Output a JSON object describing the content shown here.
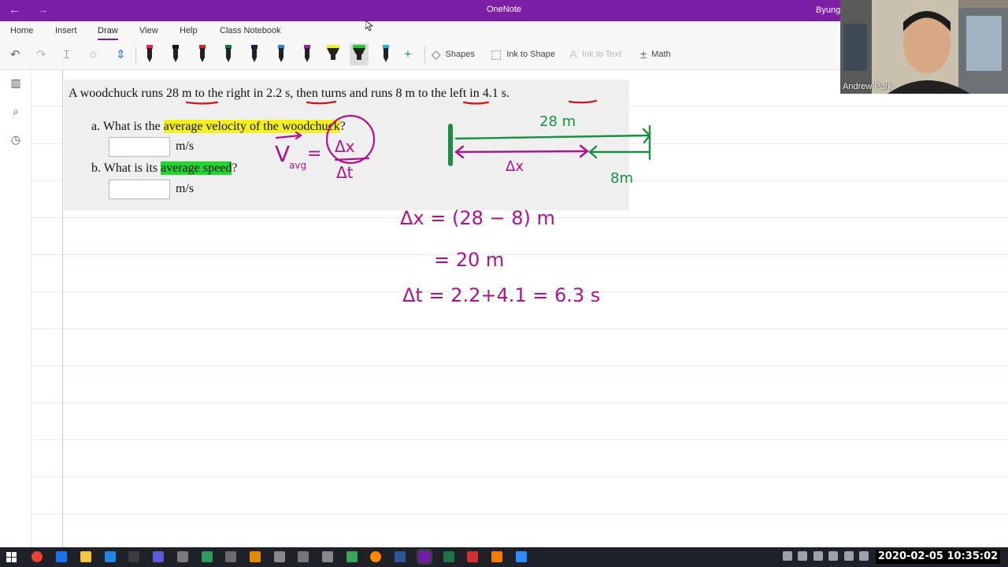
{
  "window": {
    "title": "OneNote",
    "user": "Byung"
  },
  "ribbon": {
    "tabs": [
      {
        "label": "Home"
      },
      {
        "label": "Insert"
      },
      {
        "label": "Draw"
      },
      {
        "label": "View"
      },
      {
        "label": "Help"
      },
      {
        "label": "Class Notebook"
      }
    ],
    "active_tab": "Draw",
    "tools": {
      "shapes": "Shapes",
      "ink_to_shape": "Ink to Shape",
      "ink_to_text": "Ink to Text",
      "math": "Math"
    },
    "pen_colors": [
      "#e91e63",
      "#111111",
      "#e11d1d",
      "#0b7d2f",
      "#0a1f5c",
      "#1e88e5",
      "#8e24aa",
      "#f4f01a",
      "#22c832",
      "#1bb1e8"
    ]
  },
  "problem": {
    "statement_parts": [
      "A woodchuck runs ",
      "28 m",
      " to the right in ",
      "2.2 s",
      ", then turns and runs ",
      "8 m",
      " to the left in ",
      "4.1 s",
      "."
    ],
    "part_a": {
      "prefix": "a. What is the ",
      "highlight": "average velocity of the woodchuck",
      "suffix": "?",
      "unit": "m/s"
    },
    "part_b": {
      "prefix": "b. What is its ",
      "highlight": "average speed",
      "suffix": "?",
      "unit": "m/s"
    }
  },
  "ink": {
    "vavg": "V",
    "vavg_sub": "avg",
    "equals": "=",
    "dx": "Δx",
    "dt": "Δt",
    "diagram_top": "28 m",
    "diagram_mid": "Δx",
    "diagram_right": "8m",
    "eq1": "Δx = (28 − 8) m",
    "eq2": "= 20 m",
    "eq3": "Δt = 2.2+4.1 = 6.3 s"
  },
  "webcam": {
    "name": "Andrew Park"
  },
  "taskbar": {
    "clock": "2020-02-05 10:35:02"
  },
  "colors": {
    "accent": "#7c1fa6",
    "ink_magenta": "#b0128f",
    "ink_green": "#17913f",
    "ink_red": "#d2121a",
    "highlight_yellow": "#f4f01a",
    "highlight_green": "#21d631"
  }
}
